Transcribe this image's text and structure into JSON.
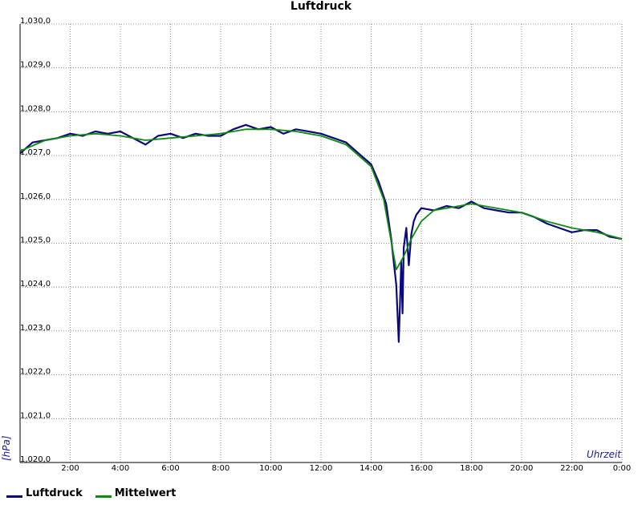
{
  "chart_data": {
    "type": "line",
    "title": "Luftdruck",
    "xlabel": "Uhrzeit",
    "ylabel": "[hPa]",
    "ylim": [
      1020.0,
      1030.0
    ],
    "xlim": [
      0,
      24
    ],
    "grid": true,
    "legend_placement": "bottom-left",
    "y_ticks": [
      "1,020,0",
      "1,021,0",
      "1,022,0",
      "1,023,0",
      "1,024,0",
      "1,025,0",
      "1,026,0",
      "1,027,0",
      "1,028,0",
      "1,029,0",
      "1,030,0"
    ],
    "x_ticks": [
      "2:00",
      "4:00",
      "6:00",
      "8:00",
      "10:00",
      "12:00",
      "14:00",
      "16:00",
      "18:00",
      "20:00",
      "22:00",
      "0:00"
    ],
    "series": [
      {
        "name": "Luftdruck",
        "color": "#0a0a7a",
        "x": [
          0,
          0.5,
          1,
          1.5,
          2,
          2.5,
          3,
          3.5,
          4,
          4.5,
          5,
          5.5,
          6,
          6.5,
          7,
          7.5,
          8,
          8.5,
          9,
          9.5,
          10,
          10.5,
          11,
          11.5,
          12,
          12.5,
          13,
          13.5,
          14,
          14.3,
          14.6,
          14.8,
          15.0,
          15.1,
          15.15,
          15.2,
          15.25,
          15.3,
          15.4,
          15.5,
          15.6,
          15.7,
          15.8,
          16,
          16.5,
          17,
          17.5,
          18,
          18.5,
          19,
          19.5,
          20,
          20.5,
          21,
          21.5,
          22,
          22.5,
          23,
          23.5,
          24
        ],
        "y": [
          1027.05,
          1027.3,
          1027.35,
          1027.4,
          1027.5,
          1027.45,
          1027.55,
          1027.5,
          1027.55,
          1027.4,
          1027.25,
          1027.45,
          1027.5,
          1027.4,
          1027.5,
          1027.45,
          1027.45,
          1027.6,
          1027.7,
          1027.6,
          1027.65,
          1027.5,
          1027.6,
          1027.55,
          1027.5,
          1027.4,
          1027.3,
          1027.05,
          1026.8,
          1026.4,
          1025.9,
          1025.1,
          1024.05,
          1022.75,
          1023.6,
          1024.6,
          1023.4,
          1024.9,
          1025.35,
          1024.5,
          1025.2,
          1025.5,
          1025.65,
          1025.8,
          1025.75,
          1025.85,
          1025.8,
          1025.95,
          1025.8,
          1025.75,
          1025.7,
          1025.7,
          1025.6,
          1025.45,
          1025.35,
          1025.25,
          1025.3,
          1025.3,
          1025.15,
          1025.1
        ]
      },
      {
        "name": "Mittelwert",
        "color": "#118a11",
        "x": [
          0,
          1,
          2,
          3,
          4,
          5,
          6,
          7,
          8,
          9,
          10,
          11,
          12,
          13,
          13.5,
          14,
          14.5,
          15.0,
          15.3,
          15.6,
          16,
          16.5,
          17,
          18,
          19,
          20,
          21,
          22,
          23,
          24
        ],
        "y": [
          1027.1,
          1027.35,
          1027.45,
          1027.5,
          1027.45,
          1027.35,
          1027.4,
          1027.45,
          1027.5,
          1027.6,
          1027.6,
          1027.55,
          1027.45,
          1027.25,
          1027.0,
          1026.75,
          1026.0,
          1024.4,
          1024.7,
          1025.1,
          1025.5,
          1025.75,
          1025.8,
          1025.9,
          1025.8,
          1025.7,
          1025.5,
          1025.35,
          1025.25,
          1025.1
        ]
      }
    ]
  }
}
